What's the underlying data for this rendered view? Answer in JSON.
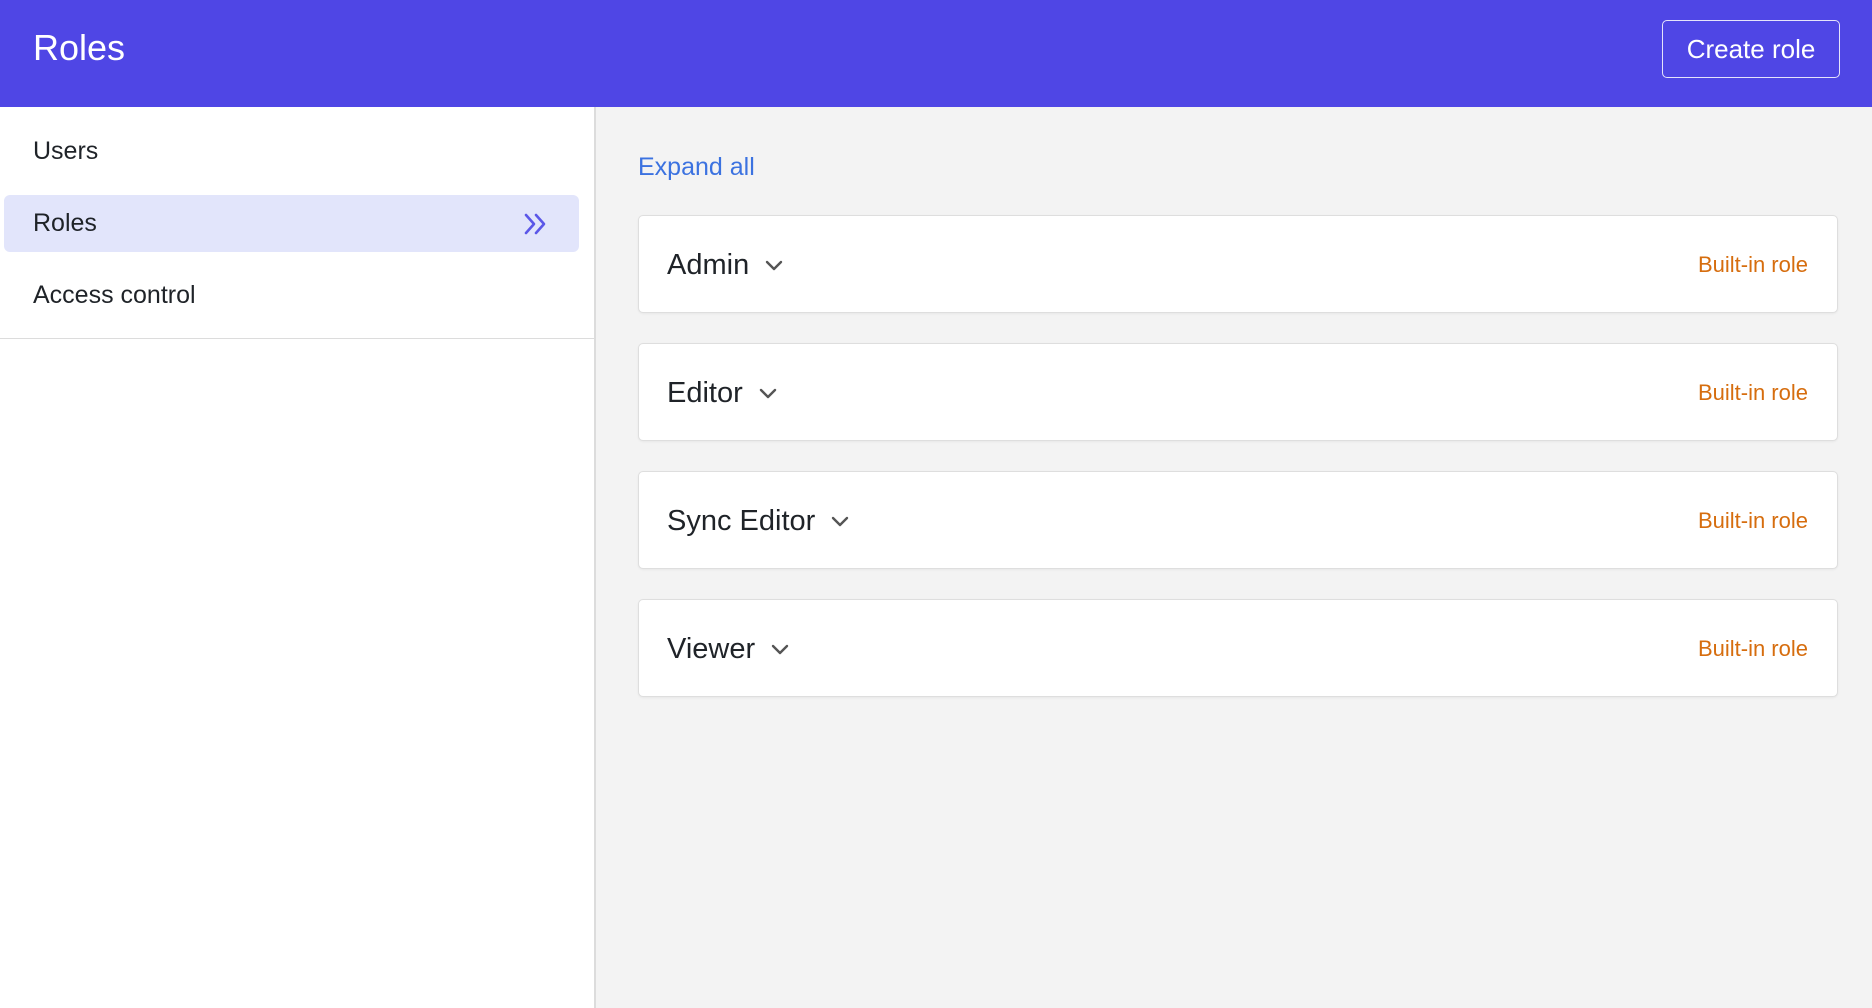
{
  "header": {
    "title": "Roles",
    "create_label": "Create role",
    "background": "#4f46e5"
  },
  "sidebar": {
    "items": [
      {
        "label": "Users",
        "active": false
      },
      {
        "label": "Roles",
        "active": true,
        "icon": "double-chevron-right-icon"
      },
      {
        "label": "Access control",
        "active": false
      }
    ]
  },
  "main": {
    "expand_all_label": "Expand all",
    "roles": [
      {
        "name": "Admin",
        "badge": "Built-in role",
        "icon": "chevron-down-icon"
      },
      {
        "name": "Editor",
        "badge": "Built-in role",
        "icon": "chevron-down-icon"
      },
      {
        "name": "Sync Editor",
        "badge": "Built-in role",
        "icon": "chevron-down-icon"
      },
      {
        "name": "Viewer",
        "badge": "Built-in role",
        "icon": "chevron-down-icon"
      }
    ]
  },
  "colors": {
    "accent": "#4f46e5",
    "active_nav_bg": "#e2e5fb",
    "link": "#3b72e0",
    "badge": "#d66d0e"
  }
}
